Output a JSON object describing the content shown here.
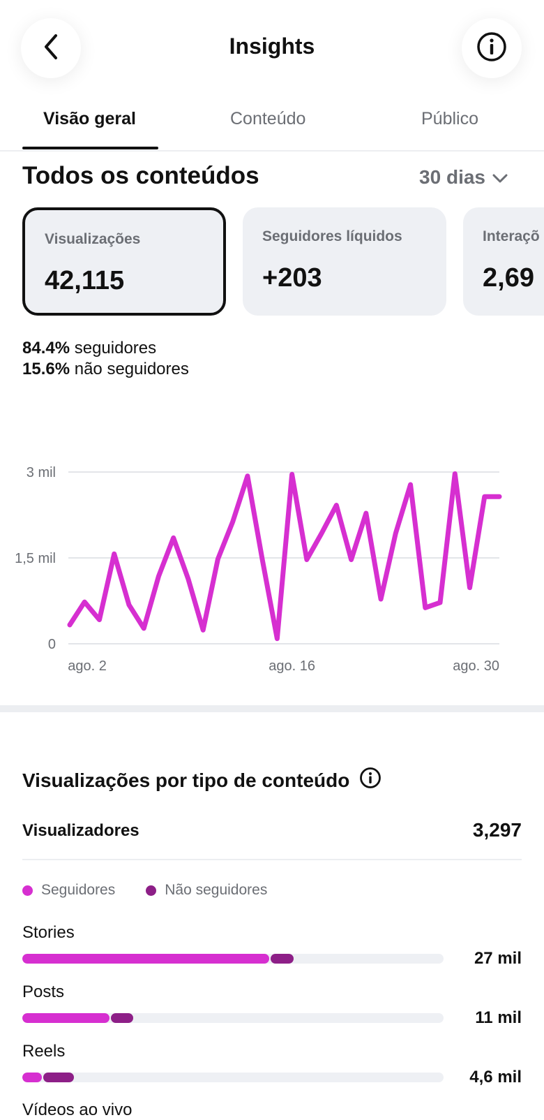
{
  "header": {
    "title": "Insights",
    "back_icon": "chevron-left-icon",
    "info_icon": "info-icon"
  },
  "tabs": [
    {
      "label": "Visão geral",
      "active": true
    },
    {
      "label": "Conteúdo",
      "active": false
    },
    {
      "label": "Público",
      "active": false
    }
  ],
  "section": {
    "title": "Todos os conteúdos",
    "range": "30 dias"
  },
  "cards": [
    {
      "label": "Visualizações",
      "value": "42,115"
    },
    {
      "label": "Seguidores líquidos",
      "value": "+203"
    },
    {
      "label": "Interaçõ",
      "value": "2,69"
    }
  ],
  "split": {
    "followers_pct": "84.4%",
    "followers_label": "seguidores",
    "nonfollowers_pct": "15.6%",
    "nonfollowers_label": "não seguidores"
  },
  "colors": {
    "accent": "#d62fd0",
    "accent_dark": "#8d1f87",
    "track": "#eef0f4"
  },
  "chart_data": {
    "type": "line",
    "x": [
      1,
      2,
      3,
      4,
      5,
      6,
      7,
      8,
      9,
      10,
      11,
      12,
      13,
      14,
      15,
      16,
      17,
      18,
      19,
      20,
      21,
      22,
      23,
      24,
      25,
      26,
      27,
      28,
      29,
      30
    ],
    "series": [
      {
        "values": [
          330,
          730,
          420,
          1570,
          680,
          270,
          1180,
          1850,
          1130,
          240,
          1480,
          2130,
          2930,
          1470,
          90,
          2960,
          1470,
          1930,
          2420,
          1470,
          2280,
          780,
          1930,
          2780,
          630,
          720,
          2970,
          980,
          2570,
          2570
        ]
      }
    ],
    "xticks": [
      {
        "x": 2,
        "label": "ago. 2"
      },
      {
        "x": 16,
        "label": "ago. 16"
      },
      {
        "x": 30,
        "label": "ago. 30"
      }
    ],
    "yticks": [
      {
        "y": 0,
        "label": "0"
      },
      {
        "y": 1500,
        "label": "1,5 mil"
      },
      {
        "y": 3000,
        "label": "3 mil"
      }
    ],
    "ylim": [
      0,
      3000
    ],
    "xlim": [
      1,
      30
    ],
    "grid": true
  },
  "breakdown": {
    "title": "Visualizações por tipo de conteúdo",
    "viewers_label": "Visualizadores",
    "viewers_value": "3,297",
    "legend": [
      {
        "label": "Seguidores",
        "color": "#d62fd0"
      },
      {
        "label": "Não seguidores",
        "color": "#8d1f87"
      }
    ],
    "rows": [
      {
        "label": "Stories",
        "value": "27 mil",
        "followers_share": 0.59,
        "nonfollowers_share": 0.05
      },
      {
        "label": "Posts",
        "value": "11 mil",
        "followers_share": 0.21,
        "nonfollowers_share": 0.05
      },
      {
        "label": "Reels",
        "value": "4,6 mil",
        "followers_share": 0.05,
        "nonfollowers_share": 0.07
      },
      {
        "label": "Vídeos ao vivo"
      }
    ]
  }
}
